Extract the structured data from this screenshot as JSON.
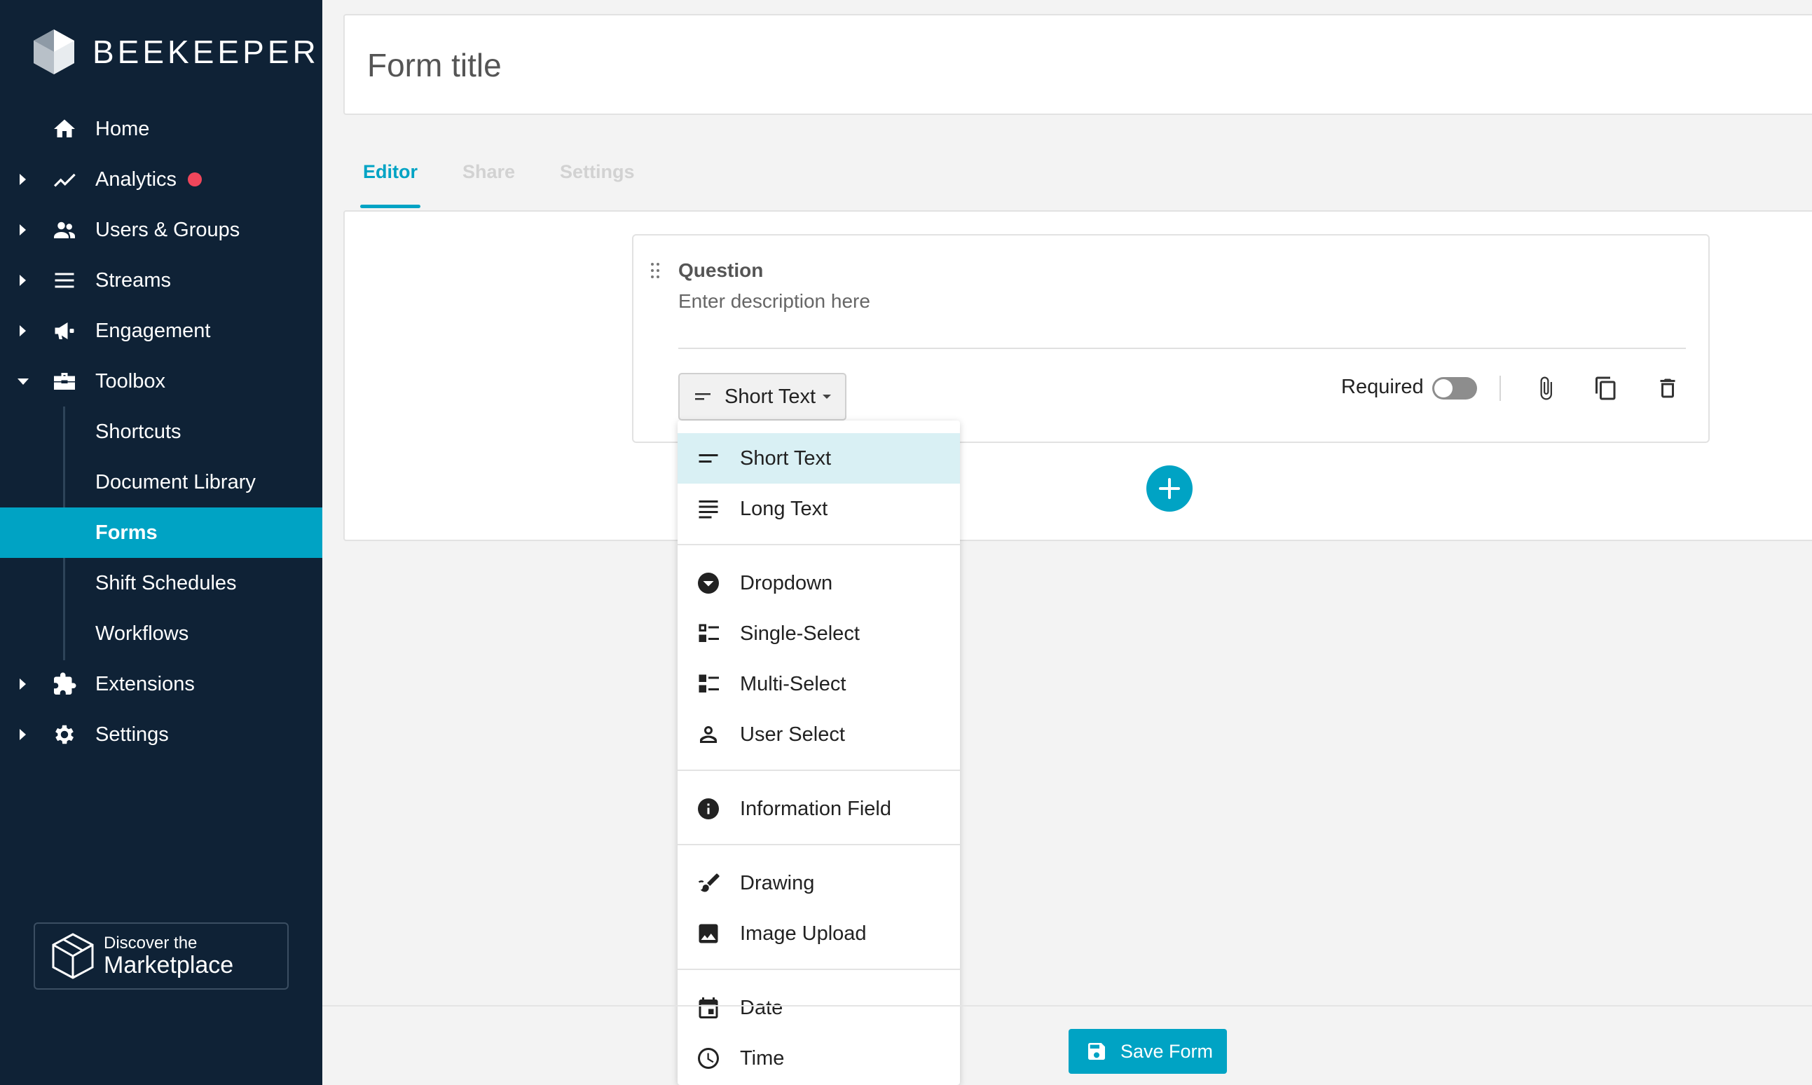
{
  "brand": {
    "name": "BEEKEEPER"
  },
  "sidebar": {
    "items": [
      {
        "label": "Home",
        "icon": "home-icon",
        "expandable": false
      },
      {
        "label": "Analytics",
        "icon": "analytics-icon",
        "expandable": true,
        "has_alert_dot": true
      },
      {
        "label": "Users & Groups",
        "icon": "users-icon",
        "expandable": true
      },
      {
        "label": "Streams",
        "icon": "streams-icon",
        "expandable": true
      },
      {
        "label": "Engagement",
        "icon": "megaphone-icon",
        "expandable": true
      },
      {
        "label": "Toolbox",
        "icon": "toolbox-icon",
        "expandable": true,
        "expanded": true
      },
      {
        "label": "Extensions",
        "icon": "puzzle-icon",
        "expandable": true
      },
      {
        "label": "Settings",
        "icon": "gear-icon",
        "expandable": true
      }
    ],
    "toolbox_children": [
      {
        "label": "Shortcuts"
      },
      {
        "label": "Document Library"
      },
      {
        "label": "Forms",
        "active": true
      },
      {
        "label": "Shift Schedules"
      },
      {
        "label": "Workflows"
      }
    ],
    "marketplace": {
      "small": "Discover the",
      "big": "Marketplace"
    }
  },
  "form": {
    "title_placeholder": "Form title",
    "tabs": [
      {
        "label": "Editor",
        "active": true
      },
      {
        "label": "Share",
        "active": false
      },
      {
        "label": "Settings",
        "active": false
      }
    ],
    "question": {
      "label": "Question",
      "description_placeholder": "Enter description here",
      "type_selected": "Short Text",
      "required_label": "Required",
      "required": false
    }
  },
  "type_menu": {
    "groups": [
      [
        {
          "label": "Short Text",
          "icon": "short-text-icon",
          "selected": true
        },
        {
          "label": "Long Text",
          "icon": "long-text-icon"
        }
      ],
      [
        {
          "label": "Dropdown",
          "icon": "dropdown-icon"
        },
        {
          "label": "Single-Select",
          "icon": "single-select-icon"
        },
        {
          "label": "Multi-Select",
          "icon": "multi-select-icon"
        },
        {
          "label": "User Select",
          "icon": "user-icon"
        }
      ],
      [
        {
          "label": "Information Field",
          "icon": "info-icon"
        }
      ],
      [
        {
          "label": "Drawing",
          "icon": "drawing-icon"
        },
        {
          "label": "Image Upload",
          "icon": "image-icon"
        }
      ],
      [
        {
          "label": "Date",
          "icon": "calendar-icon"
        },
        {
          "label": "Time",
          "icon": "clock-icon"
        }
      ]
    ]
  },
  "footer": {
    "save_label": "Save Form"
  },
  "colors": {
    "sidebar_bg": "#0f2236",
    "accent": "#00a3c4",
    "alert_dot": "#f0465b",
    "menu_selected": "#d9f0f4"
  }
}
